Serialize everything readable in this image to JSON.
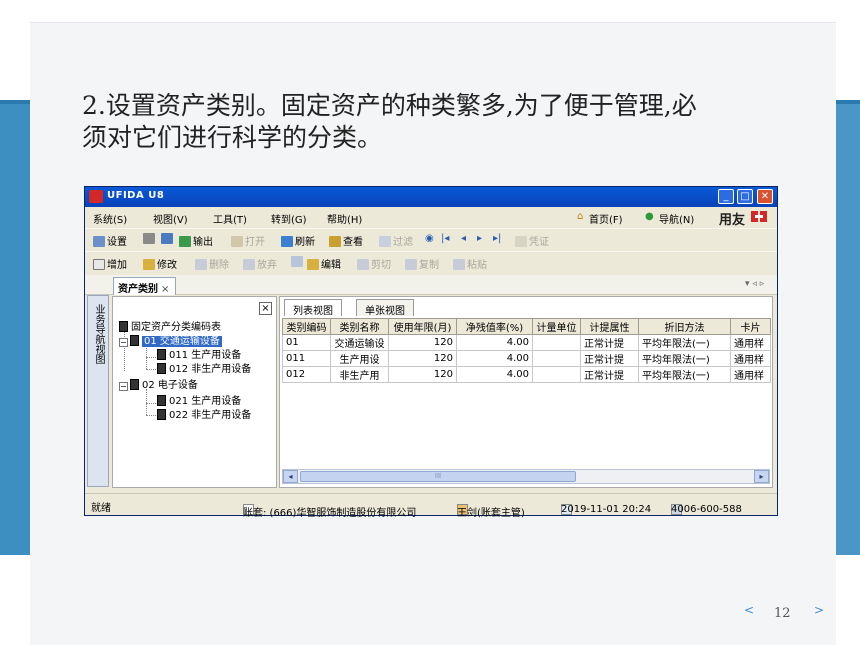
{
  "slide": {
    "heading_line1": "2.设置资产类别。固定资产的种类繁多,为了便于管理,必",
    "heading_line2": "须对它们进行科学的分类。",
    "page_number": "12",
    "prev_arrow": "<",
    "next_arrow": ">"
  },
  "window": {
    "title": "UFIDA U8",
    "menu": [
      "系统(S)",
      "视图(V)",
      "工具(T)",
      "转到(G)",
      "帮助(H)"
    ],
    "menu_right": [
      "首页(F)",
      "导航(N)"
    ],
    "brand_text": "用友",
    "toolbar1": [
      "设置",
      "输出",
      "打开",
      "刷新",
      "查看",
      "过滤",
      "凭证"
    ],
    "toolbar2": [
      "增加",
      "修改",
      "删除",
      "放弃",
      "编辑",
      "剪切",
      "复制",
      "粘贴"
    ],
    "tab_label": "资产类别",
    "tab_close": "×",
    "tab_nav": "▾ ◃ ▹",
    "sidebar_label": "业务导航视图",
    "tree": {
      "close": "×",
      "root": "固定资产分类编码表",
      "nodes": [
        {
          "label": "01 交通运输设备"
        },
        {
          "label": "011 生产用设备"
        },
        {
          "label": "012 非生产用设备"
        },
        {
          "label": "02 电子设备"
        },
        {
          "label": "021 生产用设备"
        },
        {
          "label": "022 非生产用设备"
        }
      ]
    },
    "view_tabs": [
      "列表视图",
      "单张视图"
    ],
    "grid": {
      "columns": [
        "类别编码",
        "类别名称",
        "使用年限(月)",
        "净残值率(%)",
        "计量单位",
        "计提属性",
        "折旧方法",
        "卡片"
      ],
      "rows": [
        [
          "01",
          "交通运输设",
          "120",
          "4.00",
          "",
          "正常计提",
          "平均年限法(一)",
          "通用样"
        ],
        [
          "011",
          "生产用设",
          "120",
          "4.00",
          "",
          "正常计提",
          "平均年限法(一)",
          "通用样"
        ],
        [
          "012",
          "非生产用",
          "120",
          "4.00",
          "",
          "正常计提",
          "平均年限法(一)",
          "通用样"
        ]
      ]
    },
    "scroll_grip": "III",
    "status": {
      "left": "就绪",
      "account": "账套: (666)华智服饰制造股份有限公司",
      "user": "王剑(账套主管)",
      "datetime": "2019-11-01 20:24",
      "phone": "4006-600-588"
    }
  }
}
